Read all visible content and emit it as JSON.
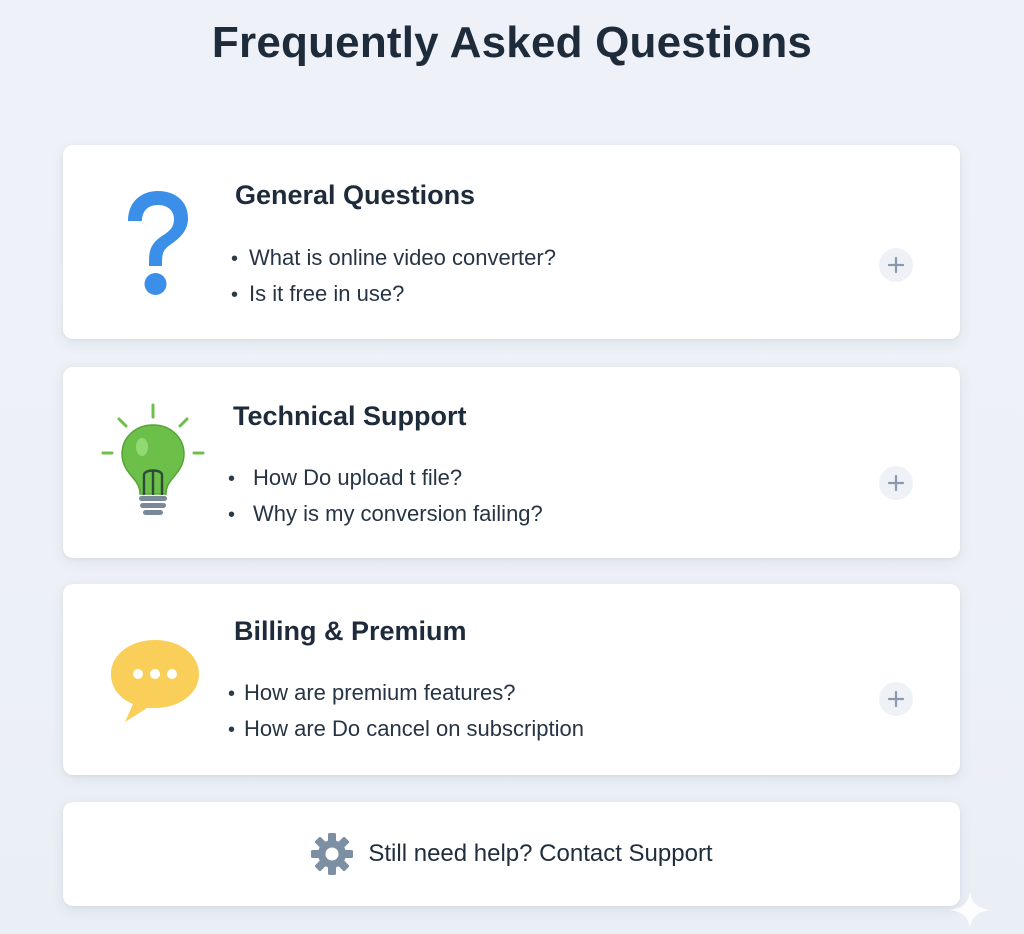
{
  "page": {
    "title": "Frequently Asked Questions"
  },
  "sections": [
    {
      "title": "General Questions",
      "icon": "question-mark-icon",
      "questions": [
        "What is online video converter?",
        "Is it free in use?"
      ]
    },
    {
      "title": "Technical Support",
      "icon": "lightbulb-icon",
      "questions": [
        "How Do upload t file?",
        "Why is my conversion failing?"
      ]
    },
    {
      "title": "Billing & Premium",
      "icon": "chat-bubble-icon",
      "questions": [
        "How are premium features?",
        "How are Do cancel on subscription"
      ]
    }
  ],
  "contact": {
    "label": "Still need help? Contact Support",
    "icon": "gear-icon"
  },
  "bullet": "•",
  "colors": {
    "background": "#eef2f8",
    "card": "#ffffff",
    "title_text": "#1e2b3b",
    "question_blue": "#3b8fe8",
    "bulb_green": "#6cc04a",
    "bubble_yellow": "#f9cf5a",
    "gear_gray": "#7d8fa3",
    "expand_bg": "#eef2f7"
  }
}
